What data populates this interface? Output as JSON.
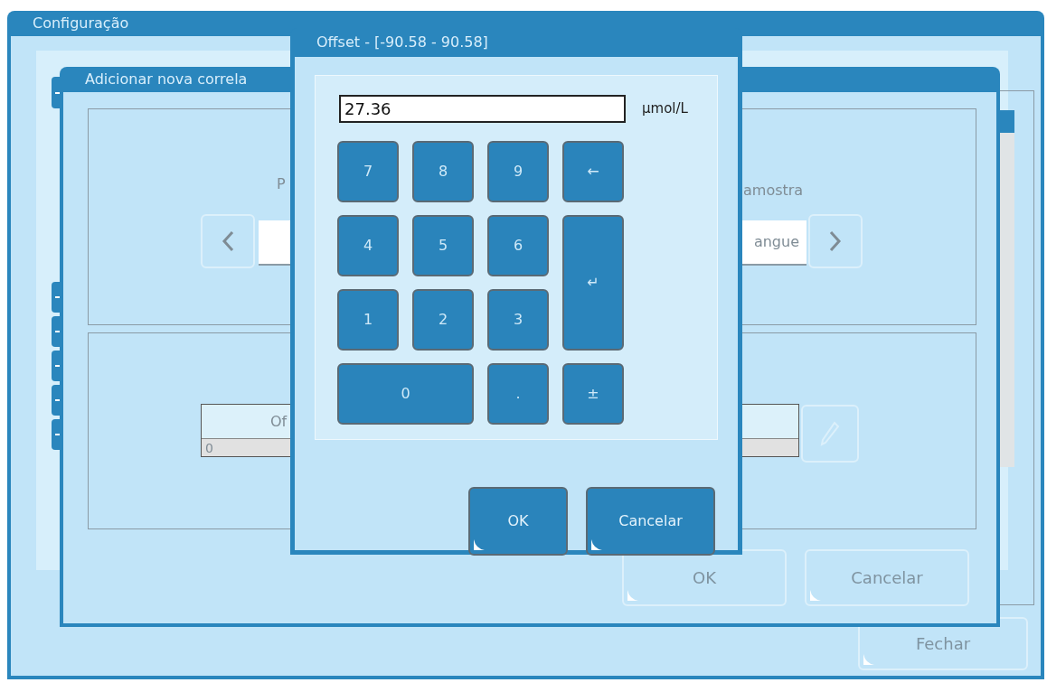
{
  "main_window": {
    "title": "Configuração",
    "close_button": "Fechar"
  },
  "back_dialog": {
    "title": "Adicionar nova correla",
    "label_left": "P",
    "label_right": "amostra",
    "selector_value": "angue",
    "table": {
      "header": "Of",
      "rows": [
        {
          "cell": "0"
        }
      ]
    },
    "buttons": [
      "OK",
      "Cancelar"
    ]
  },
  "offset_dialog": {
    "title": "Offset - [-90.58 - 90.58]",
    "value": "27.36",
    "unit": "µmol/L",
    "keys": [
      {
        "label": "7",
        "kind": "digit"
      },
      {
        "label": "8",
        "kind": "digit"
      },
      {
        "label": "9",
        "kind": "digit"
      },
      {
        "label": "←",
        "kind": "backspace"
      },
      {
        "label": "4",
        "kind": "digit"
      },
      {
        "label": "5",
        "kind": "digit"
      },
      {
        "label": "6",
        "kind": "digit"
      },
      {
        "label": "↵",
        "kind": "enter"
      },
      {
        "label": "1",
        "kind": "digit"
      },
      {
        "label": "2",
        "kind": "digit"
      },
      {
        "label": "3",
        "kind": "digit"
      },
      {
        "label": "0",
        "kind": "zero"
      },
      {
        "label": ".",
        "kind": "digit"
      },
      {
        "label": "±",
        "kind": "digit"
      }
    ],
    "buttons": [
      "OK",
      "Cancelar"
    ]
  }
}
